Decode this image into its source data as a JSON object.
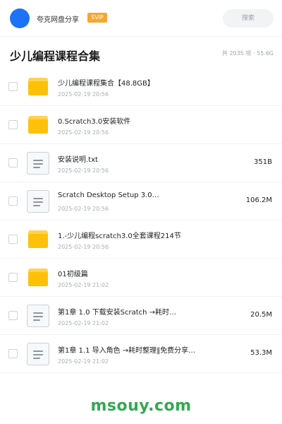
{
  "header": {
    "username": "夸克网盘分享",
    "badge": "SVIP",
    "search_placeholder": "搜索",
    "avatar_color": "#1d72f5"
  },
  "folder": {
    "title": "少儿编程课程合集",
    "summary": "共 2035 项 · 55.6G"
  },
  "files": [
    {
      "type": "folder",
      "name": "少儿编程课程集合【48.8GB】",
      "date": "2025-02-19 20:56",
      "size": ""
    },
    {
      "type": "folder",
      "name": "0.Scratch3.0安装软件",
      "date": "2025-02-19 20:56",
      "size": ""
    },
    {
      "type": "file",
      "name": "安装说明.txt",
      "date": "2025-02-19 20:56",
      "size": "351B"
    },
    {
      "type": "file",
      "name": "Scratch Desktop Setup 3.0…",
      "date": "2025-02-19 20:56",
      "size": "106.2M"
    },
    {
      "type": "folder",
      "name": "1.-少儿编程scratch3.0全套课程214节",
      "date": "2025-02-19 20:56",
      "size": ""
    },
    {
      "type": "folder",
      "name": "01初级篇",
      "date": "2025-02-19 21:02",
      "size": ""
    },
    {
      "type": "file",
      "name": "第1章 1.0 下载安装Scratch →耗时…",
      "date": "2025-02-19 21:02",
      "size": "20.5M"
    },
    {
      "type": "file",
      "name": "第1章 1.1 导入角色 →耗时整理‖免费分享…",
      "date": "2025-02-19 21:02",
      "size": "53.3M"
    }
  ],
  "watermark": "msouy.com",
  "colors": {
    "badge": "#f7a731",
    "folder": "#ffc107",
    "watermark": "#34a853"
  }
}
